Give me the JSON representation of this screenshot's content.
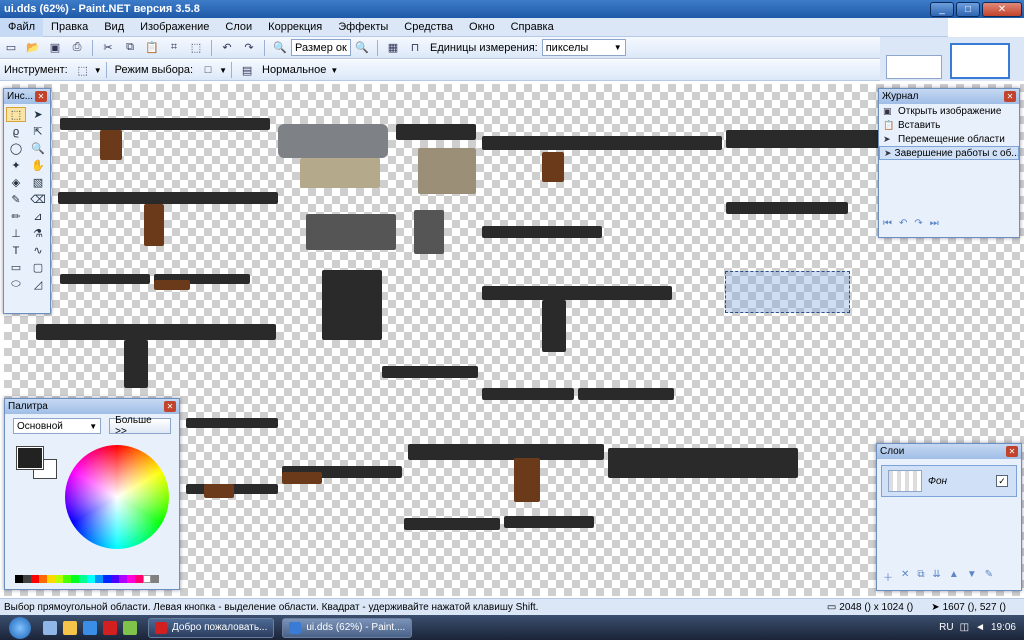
{
  "window": {
    "title": "ui.dds (62%) - Paint.NET версия 3.5.8",
    "buttons": {
      "minimize": "_",
      "maximize": "□",
      "close": "✕"
    }
  },
  "menu": [
    {
      "label": "Файл",
      "active": true
    },
    {
      "label": "Правка"
    },
    {
      "label": "Вид"
    },
    {
      "label": "Изображение"
    },
    {
      "label": "Слои"
    },
    {
      "label": "Коррекция"
    },
    {
      "label": "Эффекты"
    },
    {
      "label": "Средства"
    },
    {
      "label": "Окно"
    },
    {
      "label": "Справка"
    }
  ],
  "toolbar": {
    "zoom_label": "Размер ок",
    "units_label": "Единицы измерения:",
    "units_value": "пикселы",
    "tool_label": "Инструмент:",
    "selection_mode_label": "Режим выбора:",
    "blend_mode": "Нормальное"
  },
  "tools_panel": {
    "title": "Инс..."
  },
  "history_panel": {
    "title": "Журнал",
    "items": [
      {
        "label": "Открыть изображение",
        "icon": "image-icon"
      },
      {
        "label": "Вставить",
        "icon": "paste-icon"
      },
      {
        "label": "Перемещение области",
        "icon": "move-selection-icon"
      },
      {
        "label": "Завершение работы с об...",
        "icon": "finish-icon",
        "selected": true
      }
    ]
  },
  "palette_panel": {
    "title": "Палитра",
    "mode": "Основной",
    "more_button": "Больше >>"
  },
  "layers_panel": {
    "title": "Слои",
    "layer_name": "Фон",
    "layer_visible": true
  },
  "status": {
    "hint": "Выбор прямоугольной области. Левая кнопка - выделение области. Квадрат - удерживайте нажатой клавишу Shift.",
    "image_size": "2048 () x 1024 ()",
    "cursor_pos": "1607 (), 527 ()"
  },
  "taskbar": {
    "tasks": [
      {
        "label": "Добро пожаловать...",
        "icon_color": "#d21f1f"
      },
      {
        "label": "ui.dds (62%) - Paint....",
        "icon_color": "#3a7bd5",
        "active": true
      }
    ],
    "lang": "RU",
    "clock": "19:06"
  }
}
